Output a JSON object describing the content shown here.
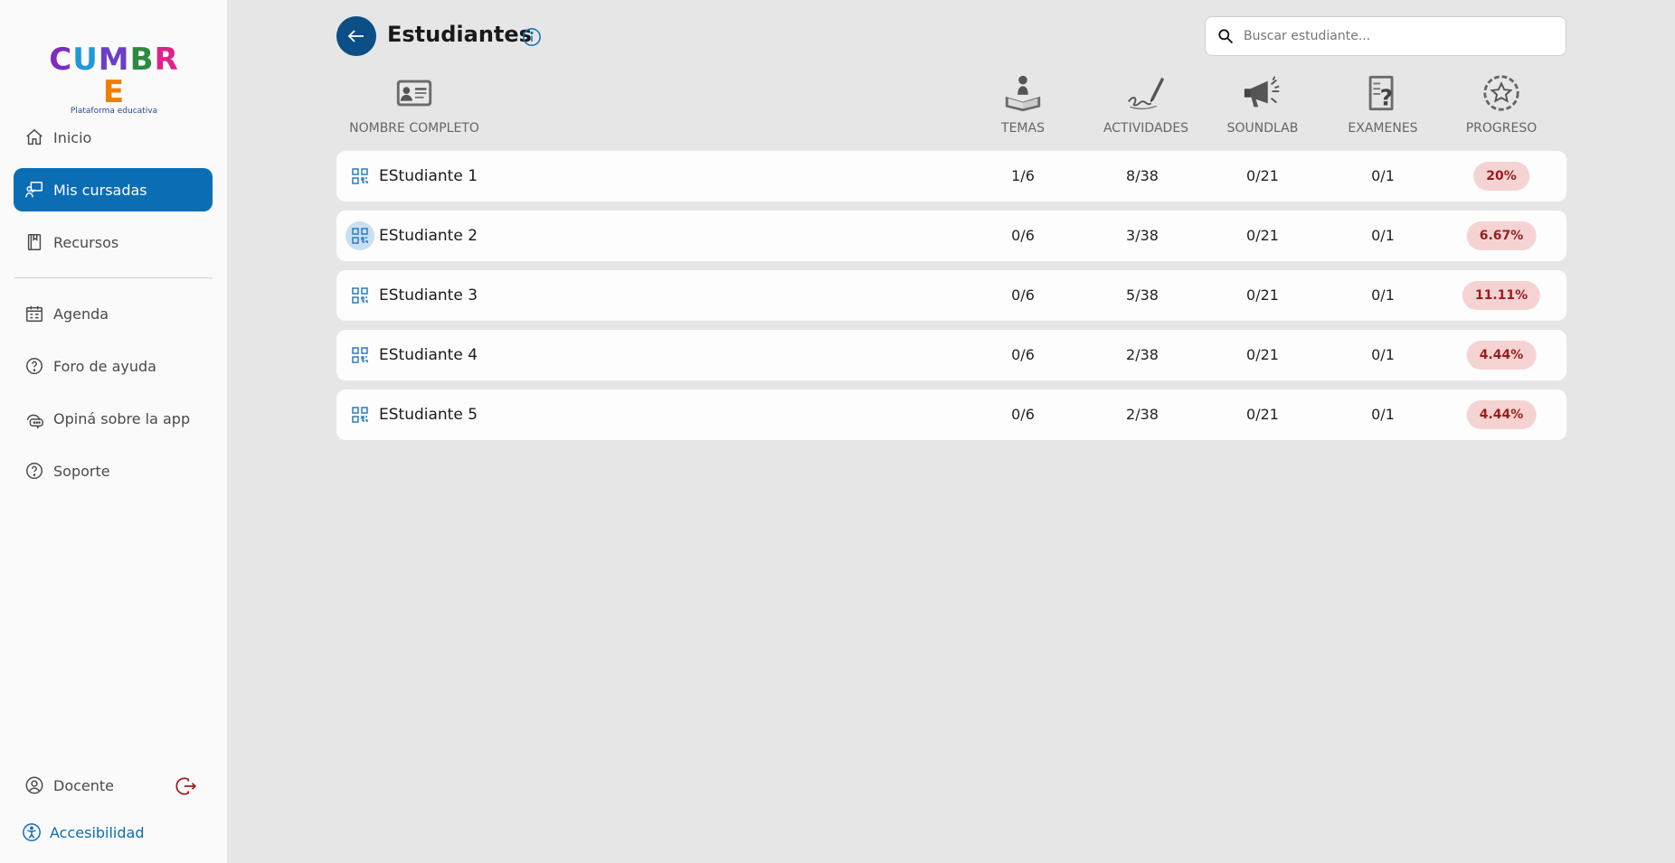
{
  "app": {
    "logo_letters": [
      "C",
      "U",
      "M",
      "B",
      "R",
      "E"
    ],
    "logo_colors": [
      "#7b2fbe",
      "#1e9ad6",
      "#6a3fc8",
      "#2b8a3e",
      "#e0218a",
      "#f07d00"
    ],
    "logo_subtitle": "Plataforma educativa"
  },
  "sidebar": {
    "items": [
      {
        "label": "Inicio",
        "icon": "home-icon",
        "active": false
      },
      {
        "label": "Mis cursadas",
        "icon": "teacher-board-icon",
        "active": true
      },
      {
        "label": "Recursos",
        "icon": "book-icon",
        "active": false
      },
      {
        "label": "Agenda",
        "icon": "calendar-icon",
        "active": false
      },
      {
        "label": "Foro de ayuda",
        "icon": "help-circle-icon",
        "active": false
      },
      {
        "label": "Opiná sobre la app",
        "icon": "chat-bubbles-icon",
        "active": false
      },
      {
        "label": "Soporte",
        "icon": "help-circle-icon",
        "active": false
      }
    ],
    "user_label": "Docente",
    "accessibility_label": "Accesibilidad"
  },
  "header": {
    "title": "Estudiantes",
    "search_placeholder": "Buscar estudiante..."
  },
  "table": {
    "columns": [
      {
        "label": "NOMBRE COMPLETO",
        "icon": "id-card-icon"
      },
      {
        "label": "TEMAS",
        "icon": "reading-person-icon"
      },
      {
        "label": "ACTIVIDADES",
        "icon": "pen-writing-icon"
      },
      {
        "label": "SOUNDLAB",
        "icon": "megaphone-icon"
      },
      {
        "label": "EXAMENES",
        "icon": "exam-question-icon"
      },
      {
        "label": "PROGRESO",
        "icon": "progress-star-icon"
      }
    ],
    "rows": [
      {
        "name": "EStudiante 1",
        "temas": "1/6",
        "actividades": "8/38",
        "soundlab": "0/21",
        "examenes": "0/1",
        "progreso": "20%"
      },
      {
        "name": "EStudiante 2",
        "temas": "0/6",
        "actividades": "3/38",
        "soundlab": "0/21",
        "examenes": "0/1",
        "progreso": "6.67%"
      },
      {
        "name": "EStudiante 3",
        "temas": "0/6",
        "actividades": "5/38",
        "soundlab": "0/21",
        "examenes": "0/1",
        "progreso": "11.11%"
      },
      {
        "name": "EStudiante 4",
        "temas": "0/6",
        "actividades": "2/38",
        "soundlab": "0/21",
        "examenes": "0/1",
        "progreso": "4.44%"
      },
      {
        "name": "EStudiante 5",
        "temas": "0/6",
        "actividades": "2/38",
        "soundlab": "0/21",
        "examenes": "0/1",
        "progreso": "4.44%"
      }
    ]
  },
  "colors": {
    "primary": "#0b6db3",
    "back_button": "#0b4f86",
    "badge_bg": "#f6d3d3",
    "badge_text": "#9b1c1c",
    "logout": "#9b1c1c"
  }
}
